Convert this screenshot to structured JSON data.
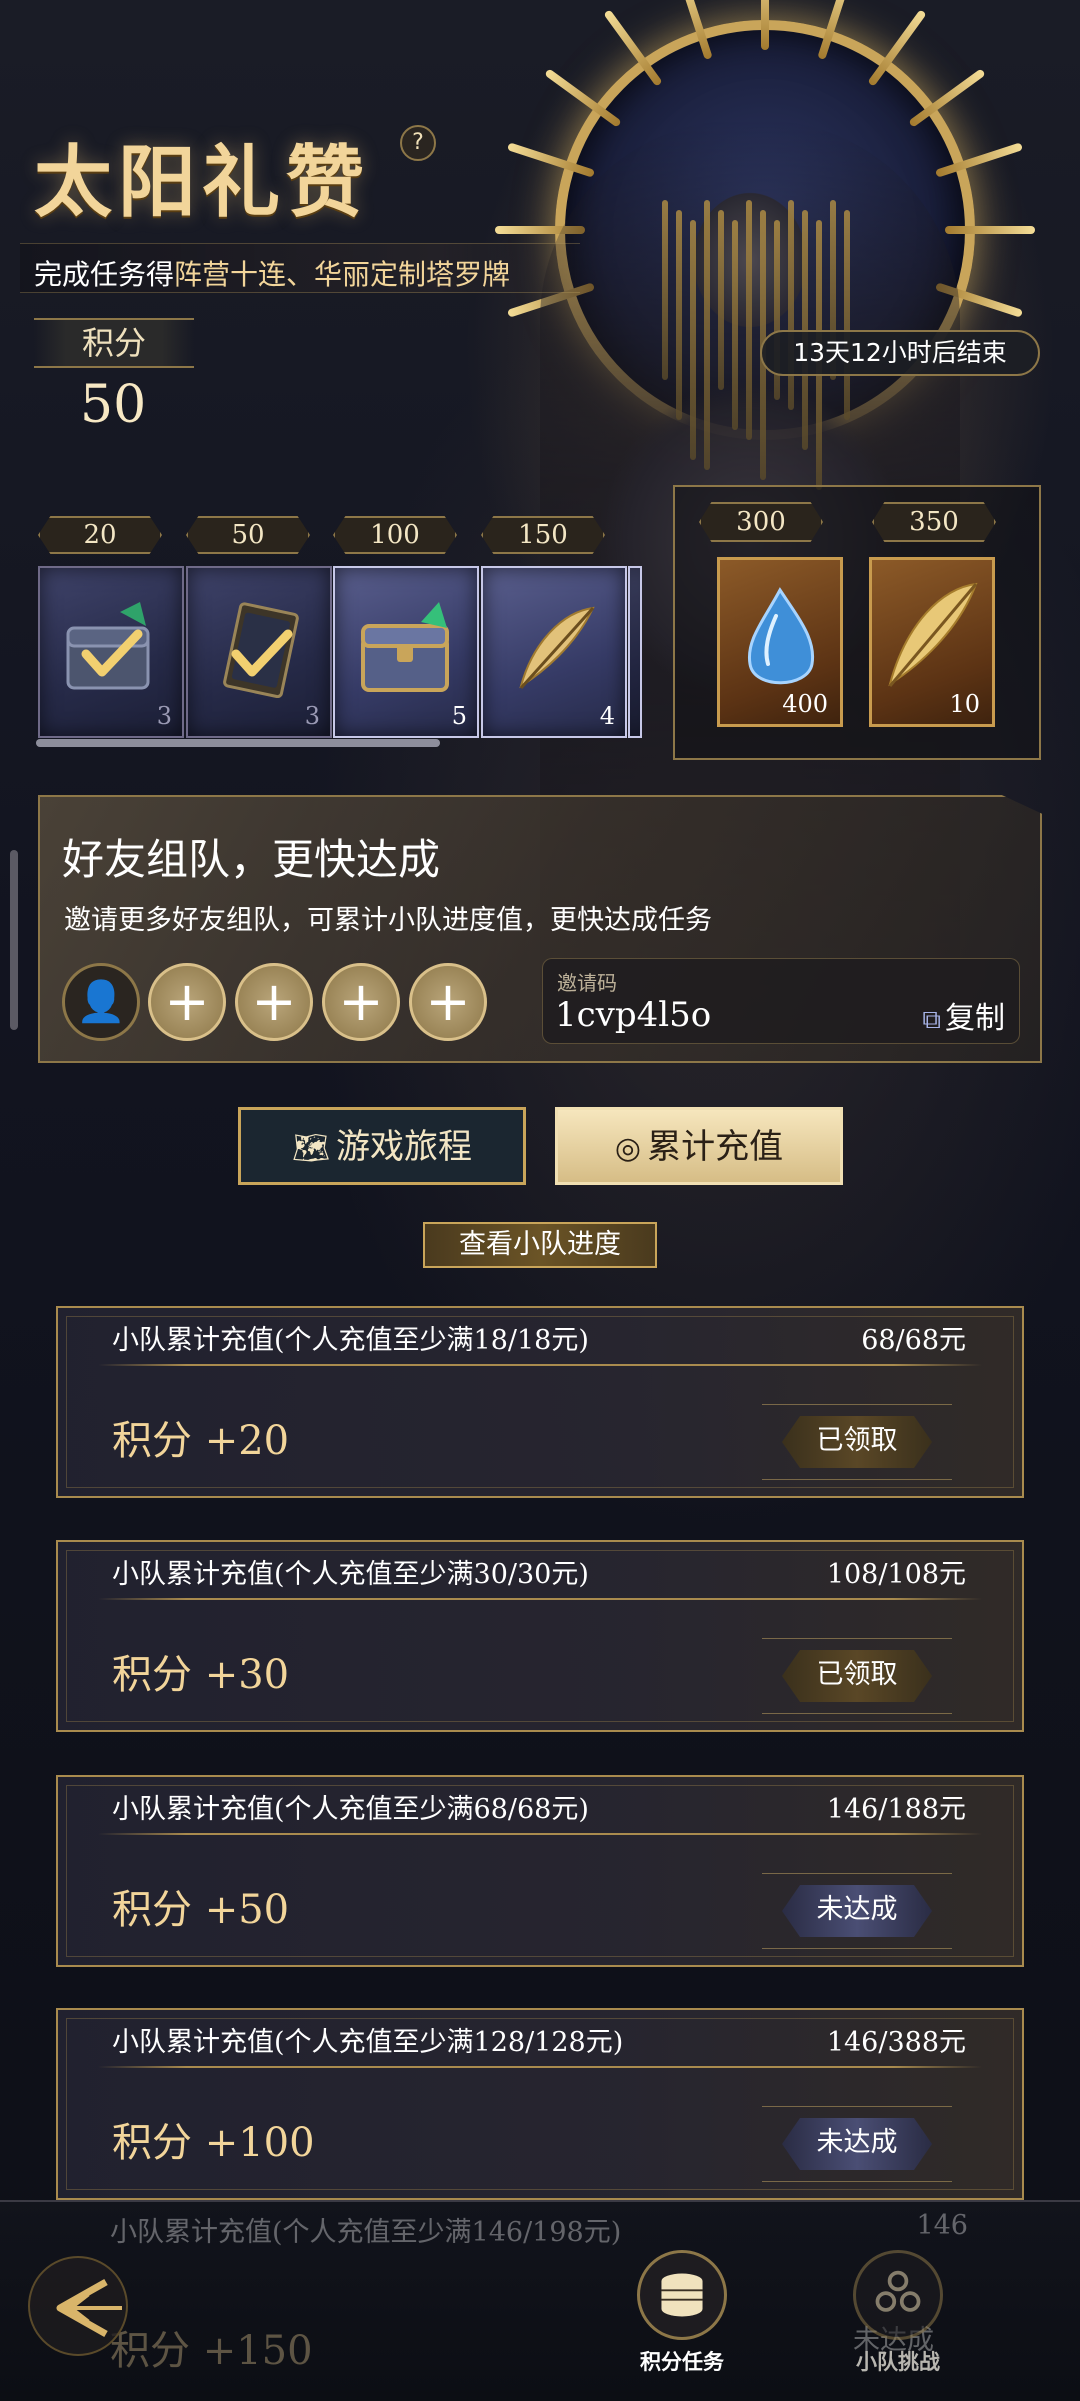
{
  "header": {
    "title": "太阳礼赞",
    "help_icon": "?",
    "subtitle_plain": "完成任务得",
    "subtitle_highlight": "阵营十连、华丽定制塔罗牌",
    "points_label": "积分",
    "points_value": "50",
    "countdown": "13天12小时后结束"
  },
  "reward_track": {
    "milestones": [
      {
        "threshold": "20",
        "count": "3",
        "icon": "chest-checked-icon",
        "state": "claimed"
      },
      {
        "threshold": "50",
        "count": "3",
        "icon": "card-checked-icon",
        "state": "claimed"
      },
      {
        "threshold": "100",
        "count": "5",
        "icon": "treasure-chest-icon",
        "state": "available"
      },
      {
        "threshold": "150",
        "count": "4",
        "icon": "golden-feather-icon",
        "state": "available"
      }
    ],
    "bonus": [
      {
        "threshold": "300",
        "count": "400",
        "icon": "blue-crystal-icon"
      },
      {
        "threshold": "350",
        "count": "10",
        "icon": "golden-feather-icon"
      }
    ]
  },
  "team": {
    "title": "好友组队，更快达成",
    "description": "邀请更多好友组队，可累计小队进度值，更快达成任务",
    "slots": [
      "me",
      "+",
      "+",
      "+",
      "+"
    ],
    "invite_label": "邀请码",
    "invite_code": "1cvp4l5o",
    "copy_label": "复制"
  },
  "tabs": [
    {
      "label": "游戏旅程",
      "icon": "map-icon",
      "active": false
    },
    {
      "label": "累计充值",
      "icon": "recharge-icon",
      "active": true
    }
  ],
  "view_progress_label": "查看小队进度",
  "tasks": [
    {
      "condition": "小队累计充值(个人充值至少满18/18元)",
      "progress": "68/68元",
      "reward": "积分 +20",
      "status": "已领取",
      "state": "claimed"
    },
    {
      "condition": "小队累计充值(个人充值至少满30/30元)",
      "progress": "108/108元",
      "reward": "积分 +30",
      "status": "已领取",
      "state": "claimed"
    },
    {
      "condition": "小队累计充值(个人充值至少满68/68元)",
      "progress": "146/188元",
      "reward": "积分 +50",
      "status": "未达成",
      "state": "pending"
    },
    {
      "condition": "小队累计充值(个人充值至少满128/128元)",
      "progress": "146/388元",
      "reward": "积分 +100",
      "status": "未达成",
      "state": "pending"
    },
    {
      "condition": "小队累计充值(个人充值至少满146/198元)",
      "progress": "146",
      "reward": "积分 +150",
      "status": "未达成",
      "state": "pending"
    }
  ],
  "nav": {
    "items": [
      {
        "label": "积分任务",
        "icon": "coin-stack-icon",
        "active": true
      },
      {
        "label": "小队挑战",
        "icon": "team-icon",
        "active": false
      }
    ]
  },
  "colors": {
    "gold": "#c9a55a",
    "gold_text": "#f2d59a",
    "bg": "#0e1016"
  }
}
